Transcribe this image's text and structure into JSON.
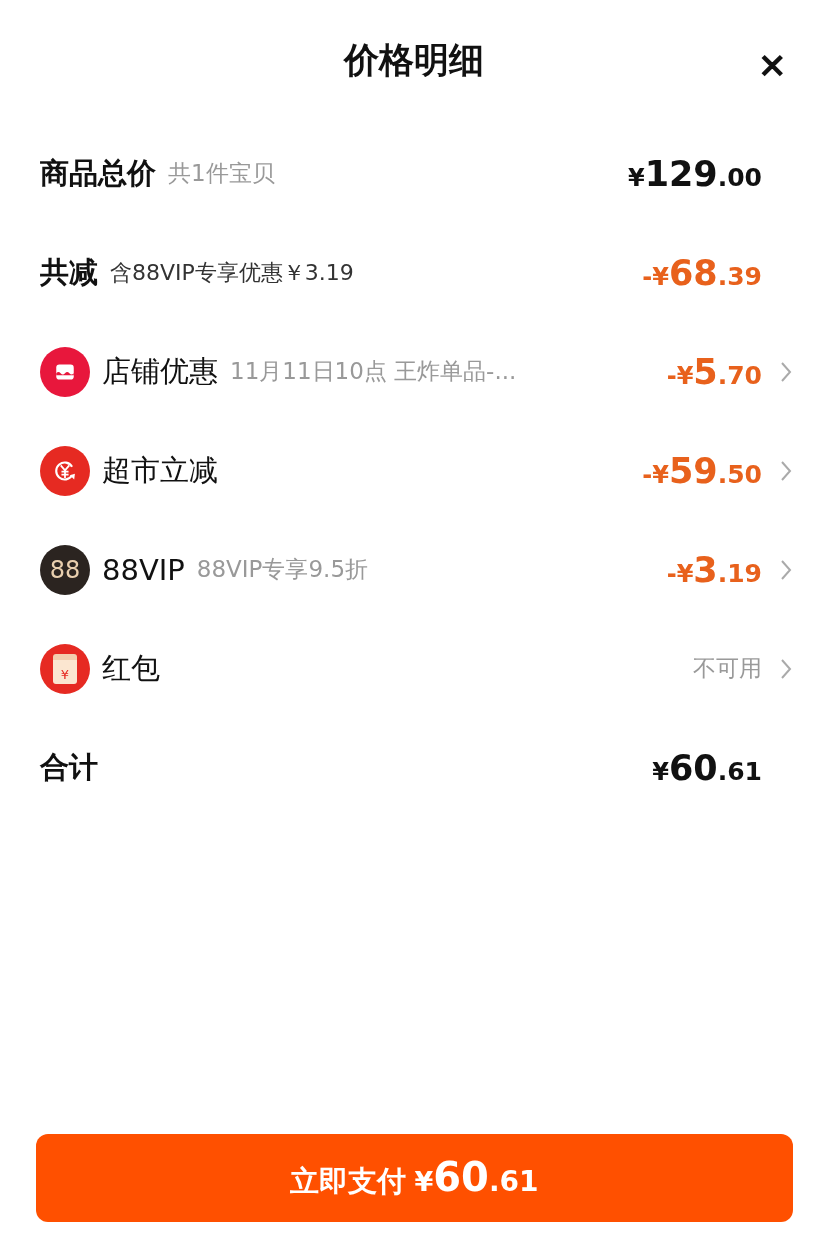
{
  "sheet": {
    "title": "价格明细",
    "close": "✕"
  },
  "rows": [
    {
      "kind": "total",
      "label": "商品总价",
      "note": "共1件宝贝",
      "amount": {
        "kind": "price",
        "prefix": "¥",
        "integer": "129",
        "decimal": ".00"
      },
      "expandable": false
    },
    {
      "kind": "summary",
      "label": "共减",
      "note": "含88VIP专享优惠￥3.19",
      "amount": {
        "kind": "deduction",
        "prefix": "-¥",
        "integer": "68",
        "decimal": ".39"
      },
      "expandable": false
    },
    {
      "kind": "shop",
      "label": "店铺优惠",
      "note": "11月11日10点 王炸单品-...",
      "amount": {
        "kind": "deduction",
        "prefix": "-¥",
        "integer": "5",
        "decimal": ".70"
      },
      "expandable": true
    },
    {
      "kind": "instant",
      "label": "超市立减",
      "amount": {
        "kind": "deduction",
        "prefix": "-¥",
        "integer": "59",
        "decimal": ".50"
      },
      "expandable": true
    },
    {
      "kind": "vip",
      "icon_text": "88",
      "label": "88VIP",
      "note": "88VIP专享9.5折",
      "amount": {
        "kind": "deduction",
        "prefix": "-¥",
        "integer": "3",
        "decimal": ".19"
      },
      "expandable": true
    },
    {
      "kind": "packet",
      "icon_text": "¥",
      "label": "红包",
      "amount": {
        "kind": "status",
        "text": "不可用"
      },
      "expandable": true
    },
    {
      "kind": "result",
      "label": "合计",
      "amount": {
        "kind": "price",
        "prefix": "¥",
        "integer": "60",
        "decimal": ".61"
      },
      "expandable": false
    }
  ],
  "pay_button": {
    "label": "立即支付",
    "prefix": "¥",
    "integer": "60",
    "decimal": ".61"
  }
}
